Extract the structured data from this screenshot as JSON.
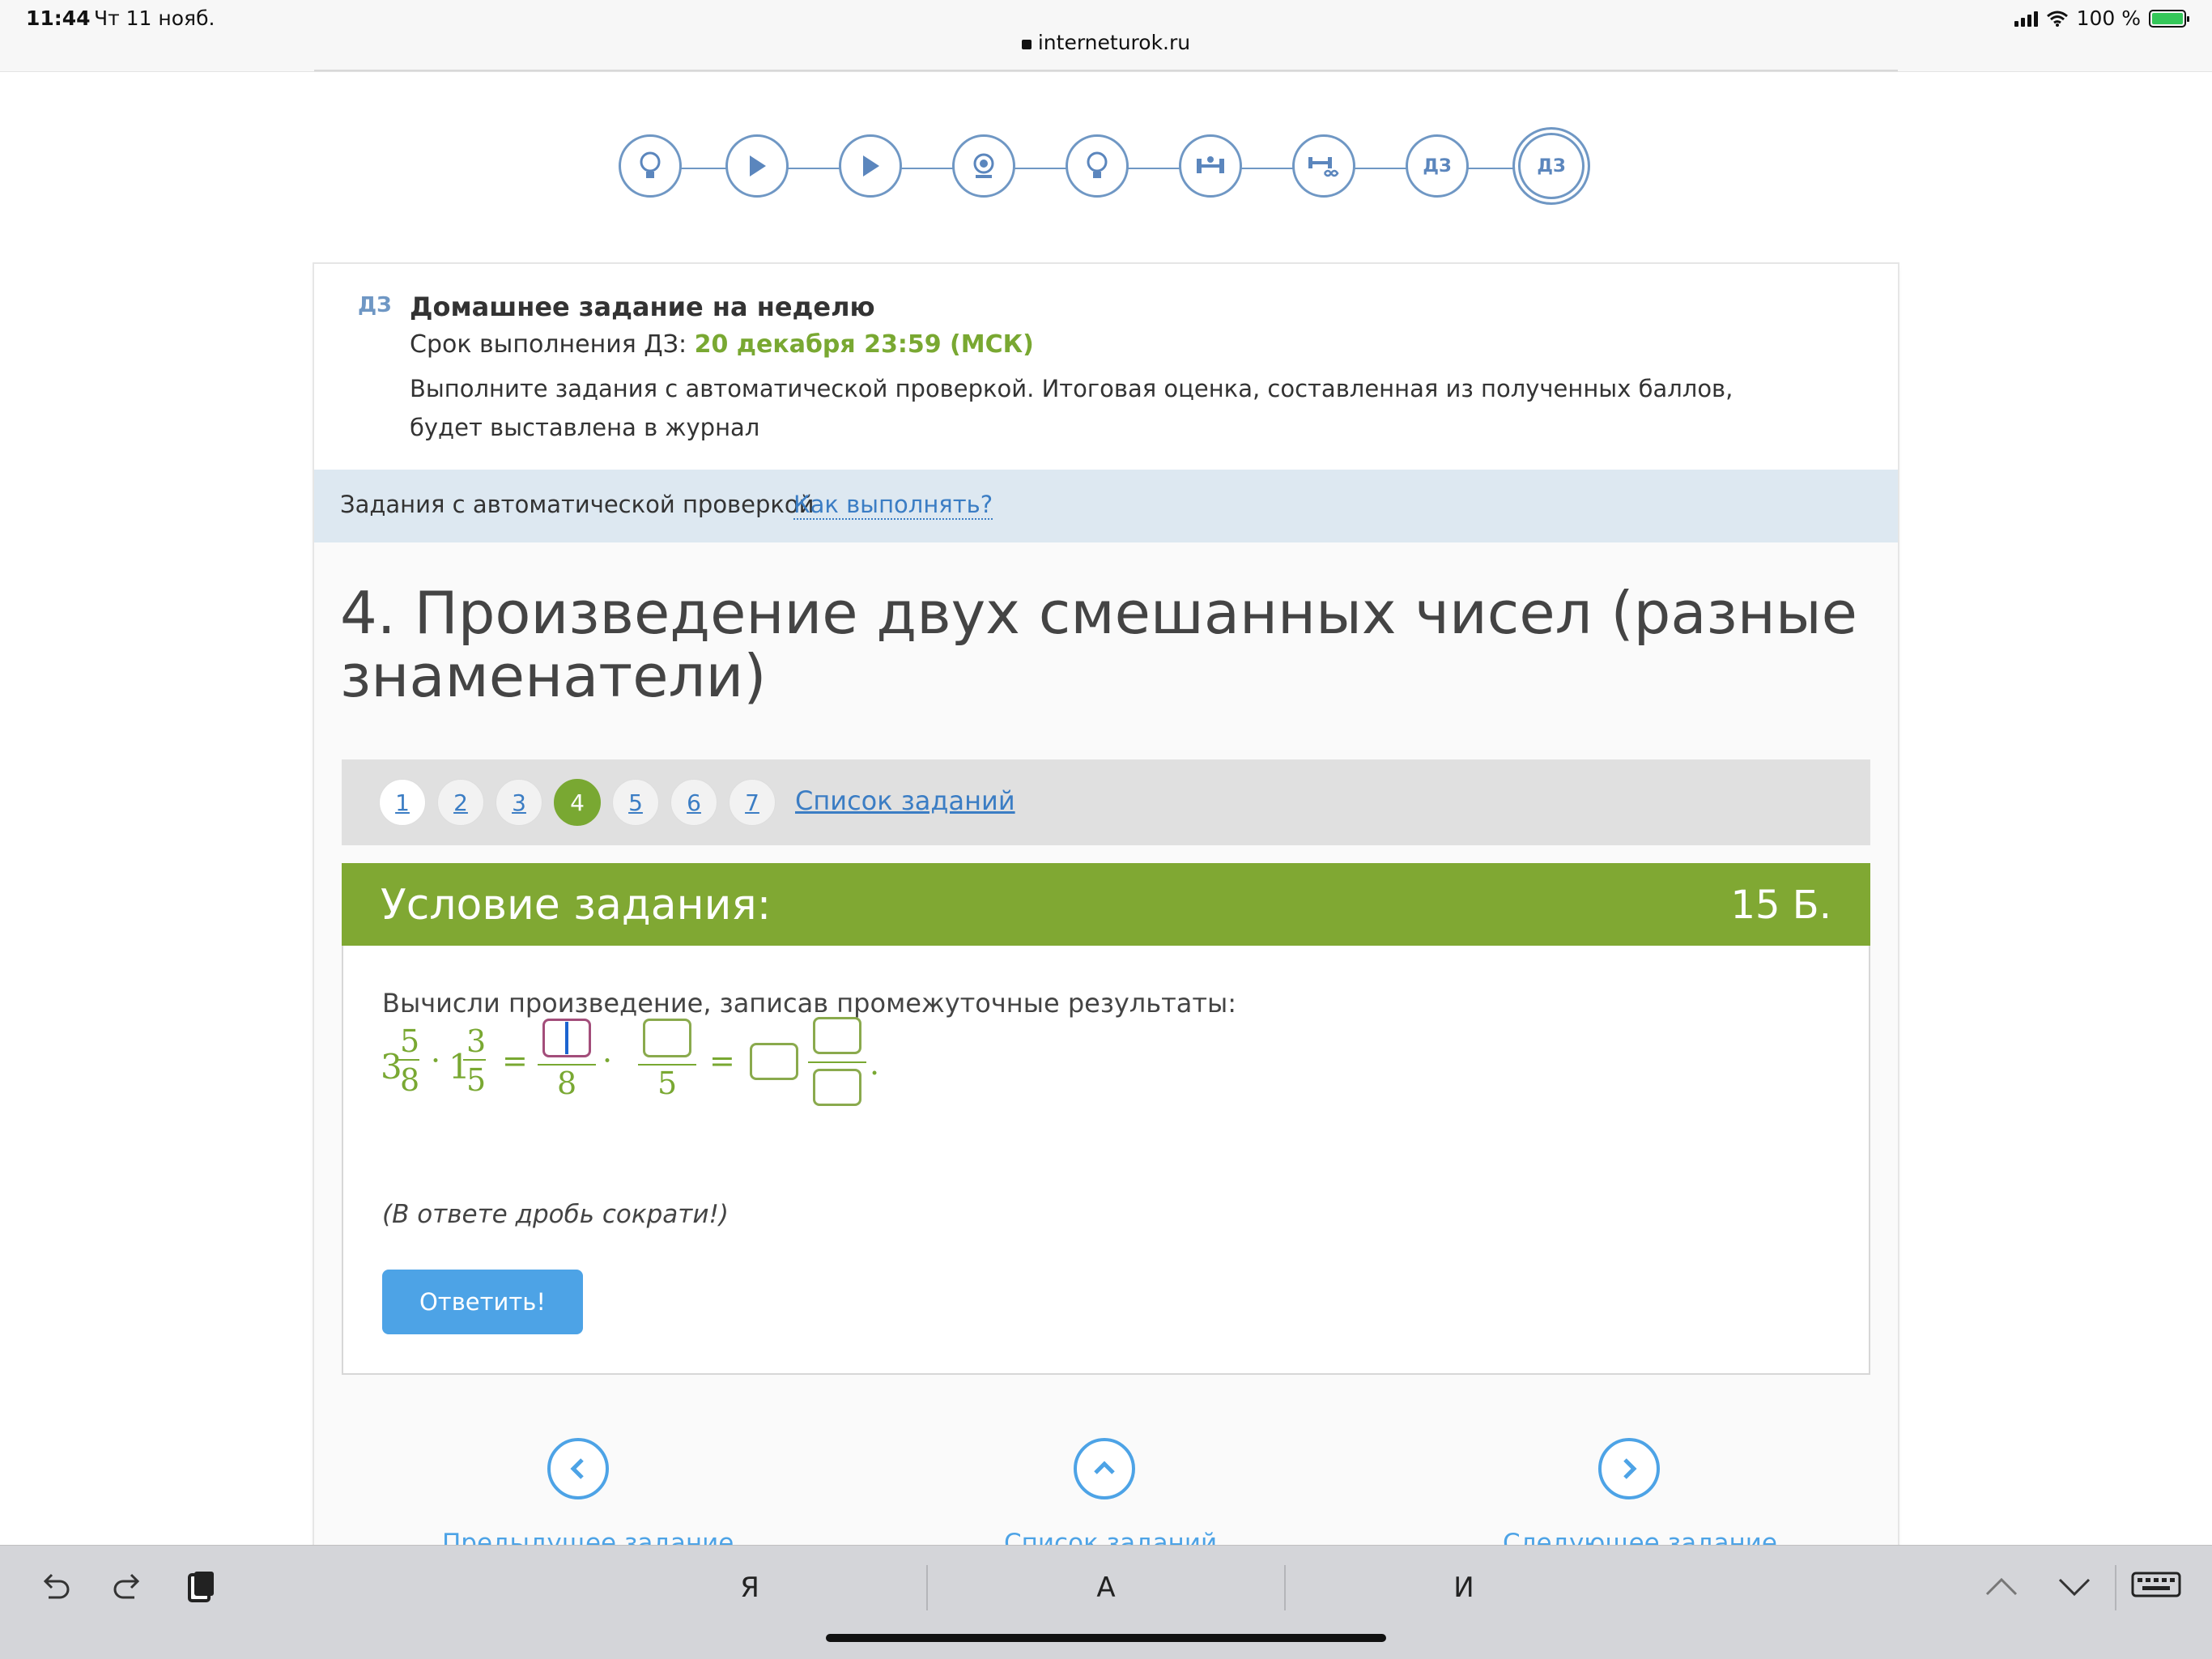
{
  "status": {
    "time": "11:44",
    "date": "Чт 11 нояб.",
    "url": "interneturok.ru",
    "battery": "100 %"
  },
  "lesson_steps": [
    {
      "icon": "lightbulb-icon"
    },
    {
      "icon": "play-icon"
    },
    {
      "icon": "play-icon"
    },
    {
      "icon": "webcam-icon"
    },
    {
      "icon": "lightbulb-icon"
    },
    {
      "icon": "barbell-icon"
    },
    {
      "icon": "barbell-infinity-icon"
    },
    {
      "label": "ДЗ"
    },
    {
      "label": "ДЗ",
      "active": true
    }
  ],
  "homework": {
    "tag": "ДЗ",
    "title": "Домашнее задание на неделю",
    "deadline_label": "Срок выполнения ДЗ:",
    "deadline_date": "20 декабря 23:59 (МСК)",
    "description": "Выполните задания с автоматической проверкой. Итоговая оценка, составленная из полученных баллов, будет выставлена в журнал"
  },
  "auto_check": {
    "label": "Задания с автоматической проверкой",
    "how_link": "Как выполнять?"
  },
  "task": {
    "title": "4. Произведение двух смешанных чисел (разные знаменатели)",
    "pages": [
      "1",
      "2",
      "3",
      "4",
      "5",
      "6",
      "7"
    ],
    "active_page": "4",
    "task_list_link": "Список заданий",
    "condition_title": "Условие задания:",
    "points": "15 Б.",
    "instruction": "Вычисли произведение, записав промежуточные результаты:",
    "math": {
      "first_whole": "3",
      "first_num": "5",
      "first_den": "8",
      "second_whole": "1",
      "second_num": "3",
      "second_den": "5",
      "multiply_sign": "·",
      "equals_sign": "=",
      "step1_den_a": "8",
      "step1_den_b": "5",
      "end_period": "."
    },
    "hint": "(В ответе дробь сократи!)",
    "answer_button": "Ответить!"
  },
  "bottom_nav": {
    "prev": "Предыдущее задание",
    "list": "Список заданий",
    "next": "Следующее задание"
  },
  "keyboard_bar": {
    "suggestions": [
      "Я",
      "А",
      "И"
    ]
  },
  "colors": {
    "accent_green": "#80a833",
    "link_blue": "#3b7dc4",
    "button_blue": "#4da3e6",
    "step_blue": "#6f97c4"
  }
}
